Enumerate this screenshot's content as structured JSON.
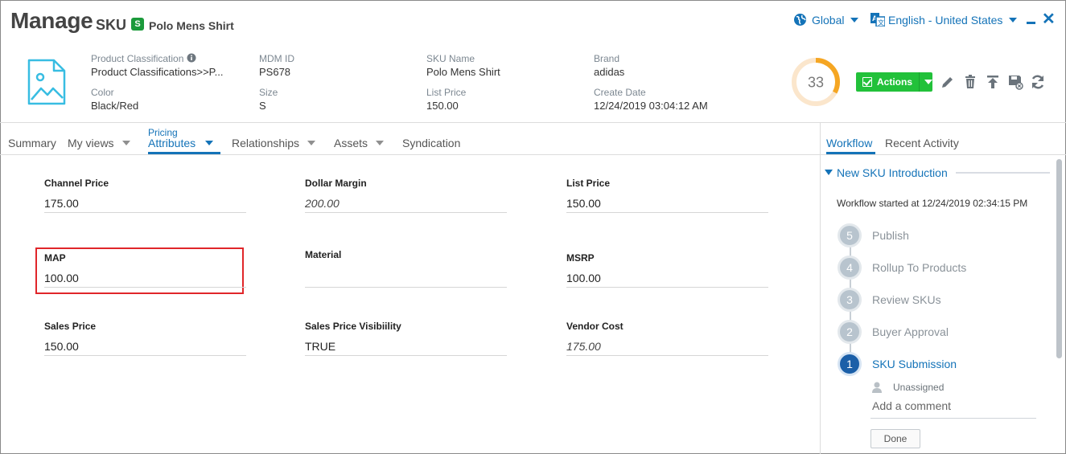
{
  "header": {
    "title": "Manage",
    "entity_type": "SKU",
    "type_badge": "S",
    "entity_name": "Polo Mens Shirt",
    "locale_global": "Global",
    "locale_language": "English - United States"
  },
  "summary": {
    "fields": [
      {
        "label": "Product Classification",
        "value": "Product Classifications>>P...",
        "info": true
      },
      {
        "label": "MDM ID",
        "value": "PS678"
      },
      {
        "label": "SKU Name",
        "value": "Polo Mens Shirt"
      },
      {
        "label": "Brand",
        "value": "adidas"
      },
      {
        "label": "Color",
        "value": "Black/Red"
      },
      {
        "label": "Size",
        "value": "S"
      },
      {
        "label": "List Price",
        "value": "150.00"
      },
      {
        "label": "Create Date",
        "value": "12/24/2019 03:04:12 AM"
      }
    ],
    "score": "33",
    "score_fraction": 0.33,
    "actions_label": "Actions"
  },
  "tabs": {
    "summary": "Summary",
    "my_views": "My views",
    "pricing_group": "Pricing",
    "attributes": "Attributes",
    "relationships": "Relationships",
    "assets": "Assets",
    "syndication": "Syndication"
  },
  "attributes": [
    {
      "label": "Channel Price",
      "value": "175.00"
    },
    {
      "label": "Dollar Margin",
      "value": "200.00"
    },
    {
      "label": "List Price",
      "value": "150.00"
    },
    {
      "label": "MAP",
      "value": "100.00"
    },
    {
      "label": "Material",
      "value": ""
    },
    {
      "label": "MSRP",
      "value": "100.00"
    },
    {
      "label": "Sales Price",
      "value": "150.00"
    },
    {
      "label": "Sales Price Visibiility",
      "value": "TRUE"
    },
    {
      "label": "Vendor Cost",
      "value": "175.00"
    }
  ],
  "right_panel": {
    "tabs": {
      "workflow": "Workflow",
      "recent_activity": "Recent Activity"
    },
    "workflow_title": "New SKU Introduction",
    "started_text": "Workflow started at 12/24/2019 02:34:15 PM",
    "steps": [
      {
        "number": "5",
        "label": "Publish"
      },
      {
        "number": "4",
        "label": "Rollup To Products"
      },
      {
        "number": "3",
        "label": "Review SKUs"
      },
      {
        "number": "2",
        "label": "Buyer Approval"
      },
      {
        "number": "1",
        "label": "SKU Submission"
      }
    ],
    "assignee": "Unassigned",
    "comment_placeholder": "Add a comment",
    "done_label": "Done"
  },
  "colors": {
    "accent": "#1473b8",
    "action_green": "#22c13a",
    "score_orange": "#f5a623",
    "highlight_red": "#e0262a"
  }
}
